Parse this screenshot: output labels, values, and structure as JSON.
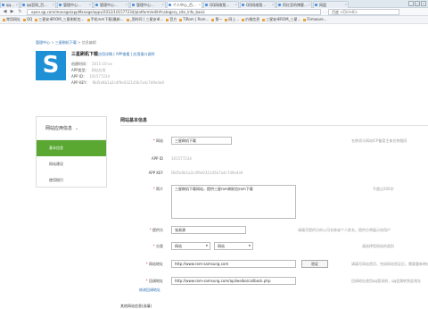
{
  "browser": {
    "tabs": [
      {
        "label": "qq...",
        "active": false
      },
      {
        "label": "qq官网_百...",
        "active": false
      },
      {
        "label": "管理中心...",
        "active": false
      },
      {
        "label": "管理中心...",
        "active": false
      },
      {
        "label": "管理中心...",
        "active": false
      },
      {
        "label": "个人中心_百...",
        "active": true
      },
      {
        "label": "QQ网络我...",
        "active": false
      },
      {
        "label": "QQ网络我...",
        "active": false
      },
      {
        "label": "阿红亚的博客...",
        "active": false
      },
      {
        "label": "网盘",
        "active": false
      }
    ],
    "window_controls": [
      "_",
      "□",
      "×"
    ],
    "url": "open.qq.com/manage/appManage/apps/2012/101577234/platform/edit#category_site_info_basic",
    "search_placeholder": "百度 <Ctrl+K>",
    "nav": {
      "back": "◀",
      "forward": "▶",
      "reload": "↻"
    },
    "bookmarks": [
      "常用网址",
      "QQ",
      "三星安卓ROM_三星刷机包...",
      "手机rom下载|最新...",
      "_用时间 | 三星安卓...",
      "官方",
      "TiRom | Rom...",
      "第一",
      "网上...",
      "价格信息",
      "三星安卓ROM_三星...",
      "Firmware..."
    ]
  },
  "page": {
    "breadcrumb": {
      "home": "管理中心",
      "sep": " > ",
      "current": "三星刷机下载",
      "tail": " > 信息编辑"
    },
    "app_icon_letter": "S",
    "app_name": "三星刷机下载",
    "app_links": "应用详情  |  APP查看  |  应用接口说明",
    "meta": [
      {
        "label": "创建时间：",
        "value": "2015-10-xx"
      },
      {
        "label": "APP类型：",
        "value": "网站应用"
      },
      {
        "label": "APP ID：",
        "value": "101577234"
      },
      {
        "label": "APP KEY：",
        "value": "f8d5e6b1a2c4f9e0321d5b7a4c7d9e4a9"
      }
    ],
    "sidebar": {
      "header": "网站应用信息",
      "items": [
        "基本信息",
        "网站建设",
        "使用指引"
      ]
    },
    "section_title": "网站基本信息",
    "form": {
      "name_label": "网站",
      "name_value": "三星刷机下载",
      "name_hint": "名称须与网站ICP备案主体名称相同",
      "appid_label": "APP ID",
      "appid_value": "101577234",
      "appkey_label": "APP KEY",
      "appkey_value": "f8d5e6b1a2c4f9e0321d5b7a4c7d9e4a9",
      "desc_label": "简介",
      "desc_value": "三星刷机下载网站，提供三星rom刷机包rom下载",
      "desc_hint": "不超过200字",
      "provider_label": "提供方",
      "provider_value": "张易源",
      "provider_hint": "请填写提供方的公司名称或个人姓名，提供方将展示给用户",
      "category_label": "分类",
      "category_main": "网站",
      "category_sub": "网站",
      "category_hint": "请选择您网站的类别",
      "site_label": "网站地址",
      "site_value": "http://www.rom-samsung.com",
      "verify_button": "验证",
      "site_hint": "请填写网站首页，完成网站验证后，需要重新审核",
      "callback_label": "回调地址",
      "callback_value": "http://www.rom-samsung.com/api/weibo/callback.php",
      "callback_hint": "回调地址使用qq登录前，qq会跳转到此地址",
      "callback_link": "修改回调地址"
    },
    "bottom_section": "其他网站信息(选填)"
  }
}
